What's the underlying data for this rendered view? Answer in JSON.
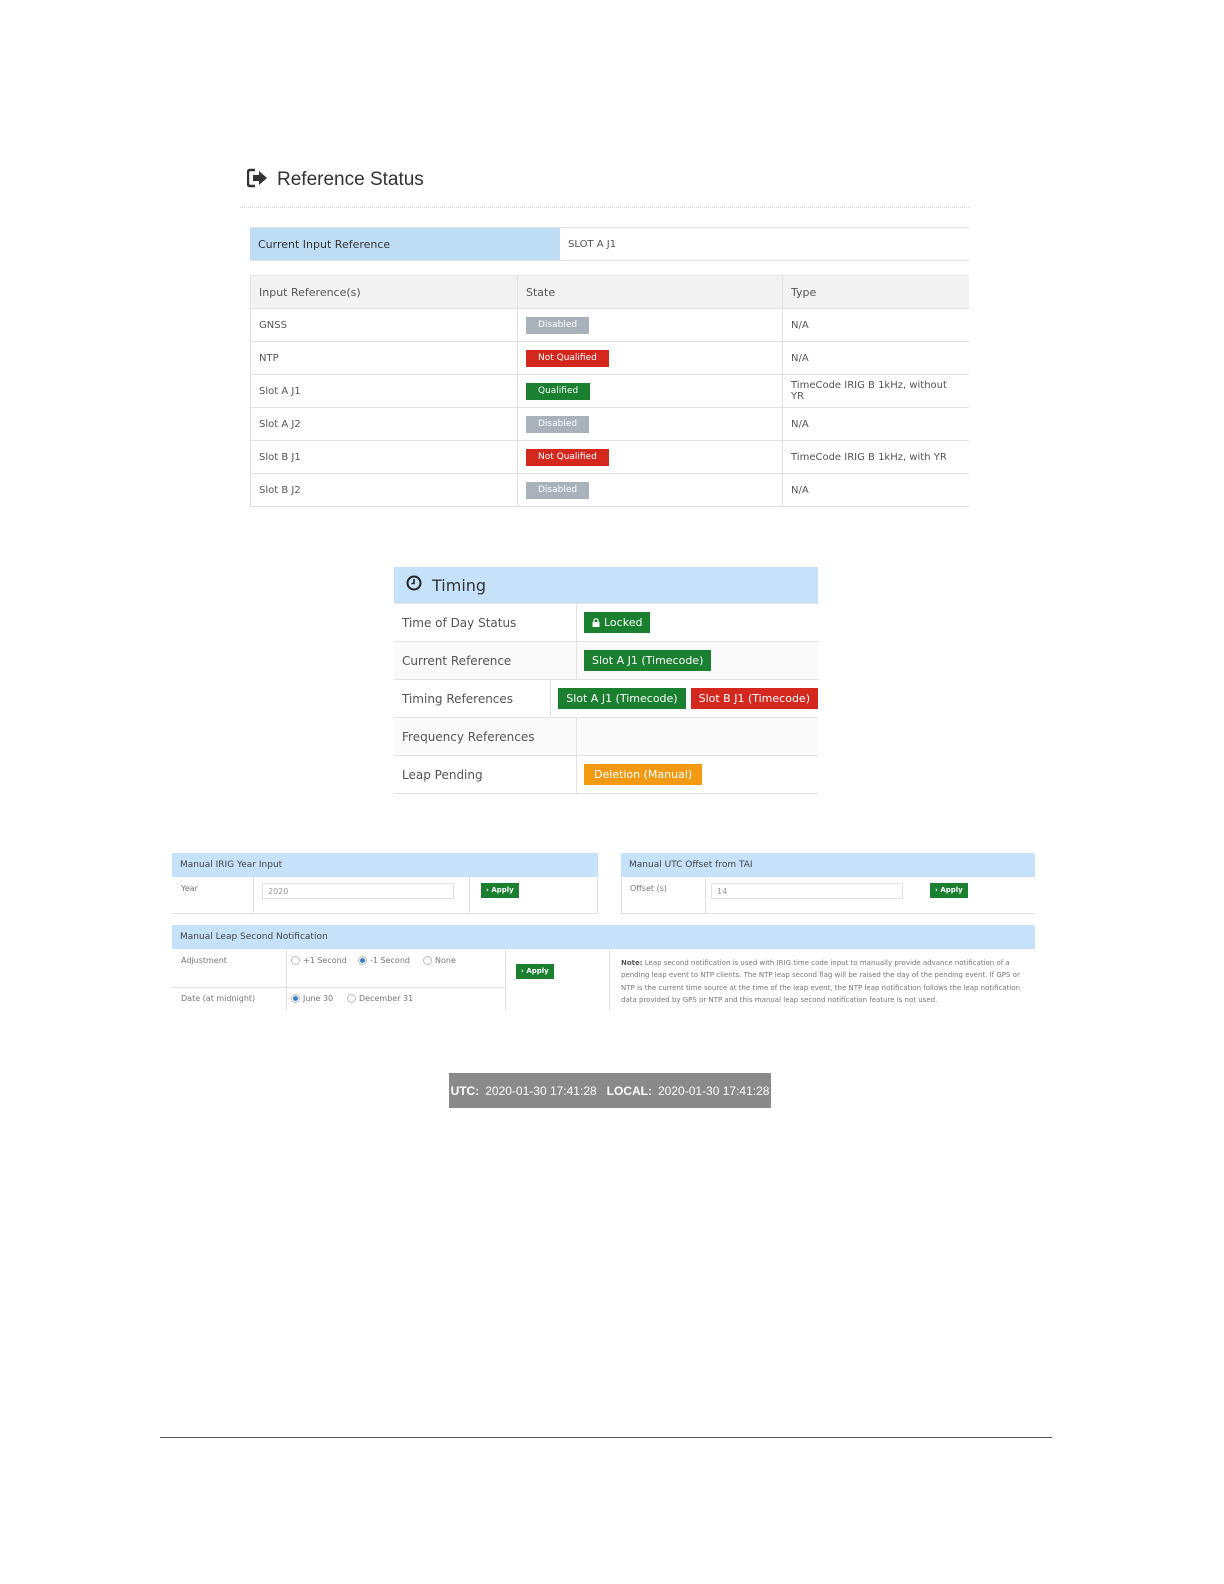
{
  "reference_status": {
    "title": "Reference Status",
    "current_input_label": "Current Input Reference",
    "current_input_value": "SLOT A J1",
    "columns": [
      "Input Reference(s)",
      "State",
      "Type"
    ],
    "rows": [
      {
        "name": "GNSS",
        "state": "Disabled",
        "type": "N/A"
      },
      {
        "name": "NTP",
        "state": "Not Qualified",
        "type": "N/A"
      },
      {
        "name": "Slot A J1",
        "state": "Qualified",
        "type": "TimeCode IRIG B 1kHz, without YR"
      },
      {
        "name": "Slot A J2",
        "state": "Disabled",
        "type": "N/A"
      },
      {
        "name": "Slot B J1",
        "state": "Not Qualified",
        "type": "TimeCode IRIG B 1kHz, with YR"
      },
      {
        "name": "Slot B J2",
        "state": "Disabled",
        "type": "N/A"
      }
    ]
  },
  "timing": {
    "title": "Timing",
    "rows": [
      {
        "label": "Time of Day Status"
      },
      {
        "label": "Current Reference"
      },
      {
        "label": "Timing References"
      },
      {
        "label": "Frequency References"
      },
      {
        "label": "Leap Pending"
      }
    ],
    "tod_status": "Locked",
    "current_reference": "Slot A J1 (Timecode)",
    "timing_ref_1": "Slot A J1 (Timecode)",
    "timing_ref_2": "Slot B J1 (Timecode)",
    "leap_pending": "Deletion (Manual)"
  },
  "irig_year": {
    "title": "Manual IRIG Year Input",
    "label": "Year",
    "value": "2020",
    "apply": "› Apply"
  },
  "utc_offset": {
    "title": "Manual UTC Offset from TAI",
    "label": "Offset (s)",
    "value": "14",
    "apply": "› Apply"
  },
  "leap_second": {
    "title": "Manual Leap Second Notification",
    "adjustment_label": "Adjustment",
    "adj_opt1": "+1 Second",
    "adj_opt2": "-1 Second",
    "adj_opt3": "None",
    "date_label": "Date (at midnight)",
    "date_opt1": "June 30",
    "date_opt2": "December 31",
    "apply": "› Apply",
    "note_bold": "Note:",
    "note_text": "Leap second notification is used with IRIG time code input to manually provide advance notification of a pending leap event to NTP clients. The NTP leap second flag will be raised the day of the pending event. If GPS or NTP is the current time source at the time of the leap event, the NTP leap notification follows the leap notification data provided by GPS or NTP and this manual leap second notification feature is not used."
  },
  "clock": {
    "utc_label": "UTC:",
    "utc_value": "2020-01-30 17:41:28",
    "local_label": "LOCAL:",
    "local_value": "2020-01-30 17:41:28"
  },
  "colors": {
    "disabled": "#a9b2bb",
    "not_qualified": "#d4281f",
    "qualified": "#1a7f2f",
    "warning": "#f39a12",
    "header_blue": "#c6e1fa"
  }
}
